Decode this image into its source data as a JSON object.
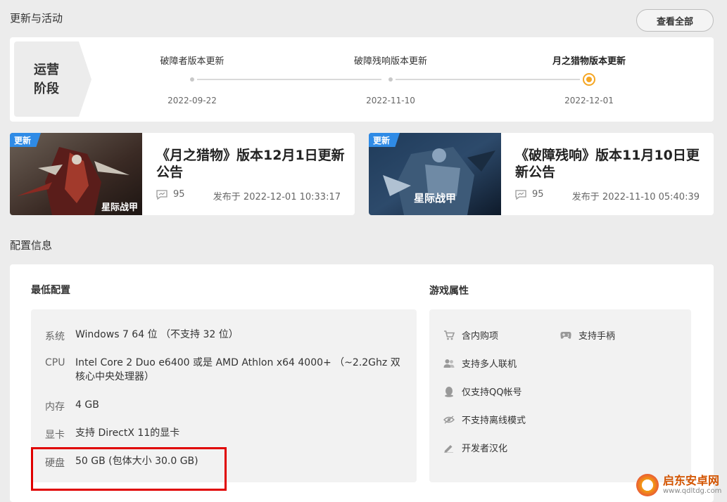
{
  "updates": {
    "section_title": "更新与活动",
    "view_all_label": "查看全部",
    "stage": {
      "line1": "运营",
      "line2": "阶段"
    },
    "timeline": [
      {
        "title": "破障者版本更新",
        "date": "2022-09-22",
        "active": false
      },
      {
        "title": "破障残响版本更新",
        "date": "2022-11-10",
        "active": false
      },
      {
        "title": "月之猎物版本更新",
        "date": "2022-12-01",
        "active": true
      }
    ],
    "news": [
      {
        "badge": "更新",
        "title": "《月之猎物》版本12月1日更新公告",
        "comments": "95",
        "date": "发布于 2022-12-01 10:33:17",
        "logo_text": "星际战甲"
      },
      {
        "badge": "更新",
        "title": "《破障残响》版本11月10日更新公告",
        "comments": "95",
        "date": "发布于 2022-11-10 05:40:39",
        "logo_text": "星际战甲"
      }
    ]
  },
  "config": {
    "section_title": "配置信息",
    "min_title": "最低配置",
    "specs": [
      {
        "label": "系统",
        "value": "Windows 7 64 位 （不支持 32 位）"
      },
      {
        "label": "CPU",
        "value": "Intel Core 2 Duo e6400 或是 AMD Athlon x64 4000+ （~2.2Ghz 双核心中央处理器）"
      },
      {
        "label": "内存",
        "value": "4 GB"
      },
      {
        "label": "显卡",
        "value": "支持 DirectX 11的显卡"
      },
      {
        "label": "硬盘",
        "value": "50 GB (包体大小 30.0 GB)"
      }
    ],
    "attr_title": "游戏属性",
    "attributes": [
      {
        "label": "含内购项",
        "icon": "cart-icon"
      },
      {
        "label": "支持手柄",
        "icon": "gamepad-icon"
      },
      {
        "label": "支持多人联机",
        "icon": "multiplayer-icon"
      },
      {
        "label": "仅支持QQ帐号",
        "icon": "qq-icon"
      },
      {
        "label": "不支持离线模式",
        "icon": "offline-icon"
      },
      {
        "label": "开发者汉化",
        "icon": "pen-icon"
      }
    ]
  },
  "watermark": {
    "name": "启东安卓网",
    "url": "www.qdltdg.com"
  },
  "colors": {
    "accent": "#f5a623",
    "badge": "#2f8be6",
    "highlight": "#e00000"
  }
}
